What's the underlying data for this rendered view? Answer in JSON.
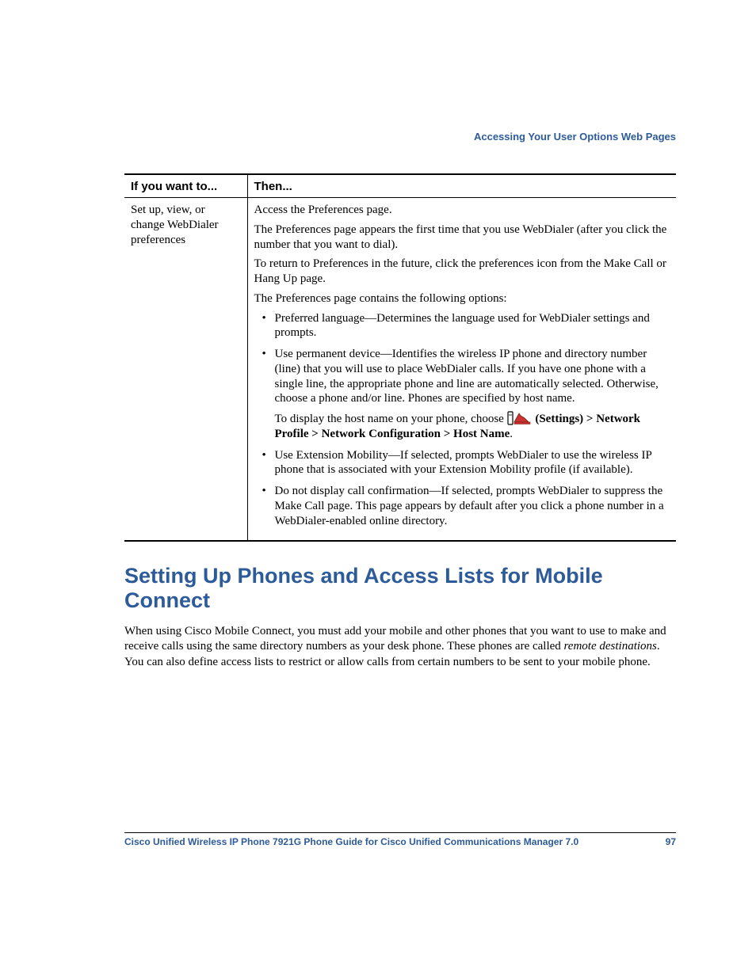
{
  "header": {
    "running": "Accessing Your User Options Web Pages"
  },
  "table": {
    "columns": [
      "If you want to...",
      "Then..."
    ],
    "row": {
      "col1": "Set up, view, or change WebDialer preferences",
      "p1": "Access the Preferences page.",
      "p2": "The Preferences page appears the first time that you use WebDialer (after you click the number that you want to dial).",
      "p3": "To return to Preferences in the future, click the preferences icon from the Make Call or Hang Up page.",
      "p4": "The Preferences page contains the following options:",
      "bullets": {
        "b1": "Preferred language—Determines the language used for WebDialer settings and prompts.",
        "b2": "Use permanent device—Identifies the wireless IP phone and directory number (line) that you will use to place WebDialer calls. If you have one phone with a single line, the appropriate phone and line are automatically selected. Otherwise, choose a phone and/or line. Phones are specified by host name.",
        "b2_sub_pre": "To display the host name on your phone, choose ",
        "b2_sub_bold": " (Settings) > Network Profile > Network Configuration > Host Name",
        "b3": "Use Extension Mobility—If selected, prompts WebDialer to use the wireless IP phone that is associated with your Extension Mobility profile (if available).",
        "b4": "Do not display call confirmation—If selected, prompts WebDialer to suppress the Make Call page. This page appears by default after you click a phone number in a WebDialer-enabled online directory."
      }
    }
  },
  "section": {
    "heading": "Setting Up Phones and Access Lists for Mobile Connect",
    "para_pre": "When using Cisco Mobile Connect, you must add your mobile and other phones that you want to use to make and receive calls using the same directory numbers as your desk phone. These phones are called ",
    "para_em": "remote destinations",
    "para_post": ". You can also define access lists to restrict or allow calls from certain numbers to be sent to your mobile phone."
  },
  "footer": {
    "title": "Cisco Unified Wireless IP Phone 7921G Phone Guide for Cisco Unified Communications Manager 7.0",
    "page": "97"
  }
}
